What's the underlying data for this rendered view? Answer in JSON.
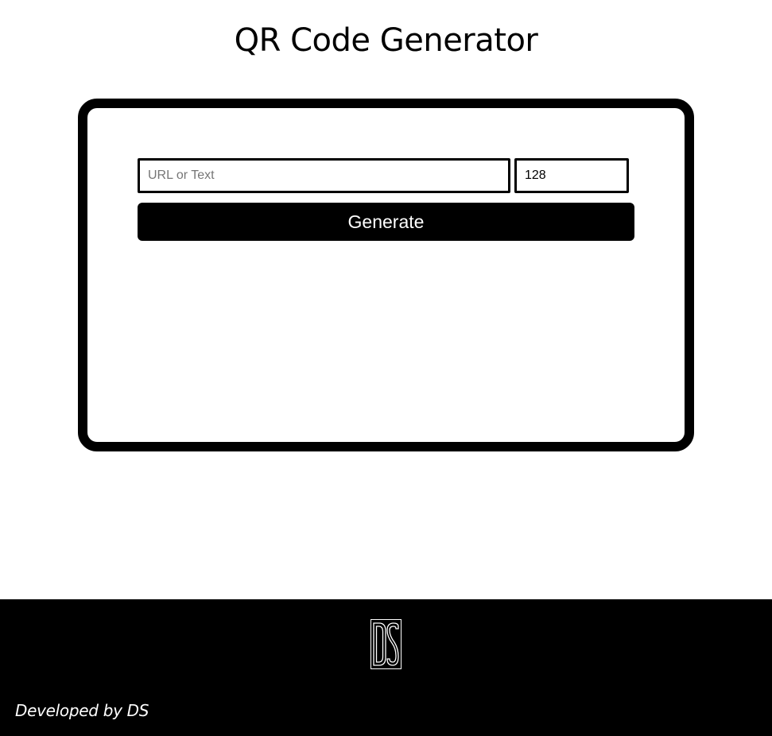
{
  "header": {
    "title": "QR Code Generator"
  },
  "form": {
    "text_placeholder": "URL or Text",
    "text_value": "",
    "size_value": "128",
    "generate_label": "Generate"
  },
  "footer": {
    "logo_text": "DS",
    "credit": "Developed by DS"
  },
  "colors": {
    "background": "#ffffff",
    "primary": "#000000",
    "button_text": "#ffffff",
    "placeholder": "#767676"
  }
}
